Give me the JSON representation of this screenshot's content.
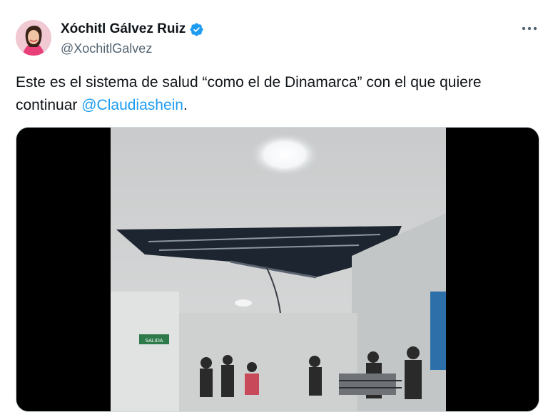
{
  "author": {
    "display_name": "Xóchitl Gálvez Ruiz",
    "handle": "@XochitlGalvez",
    "verified": true,
    "verified_color": "#1d9bf0"
  },
  "menu_icon": "more-horizontal-icon",
  "tweet": {
    "text_before": "Este es el sistema de salud “como el de Dinamarca” con el que quiere continuar ",
    "mention": "@Claudiashein",
    "text_after": "."
  },
  "media": {
    "type": "video",
    "sign_text": "SALIDA",
    "colors": {
      "mention": "#1d9bf0",
      "secondary_text": "#536471"
    }
  }
}
